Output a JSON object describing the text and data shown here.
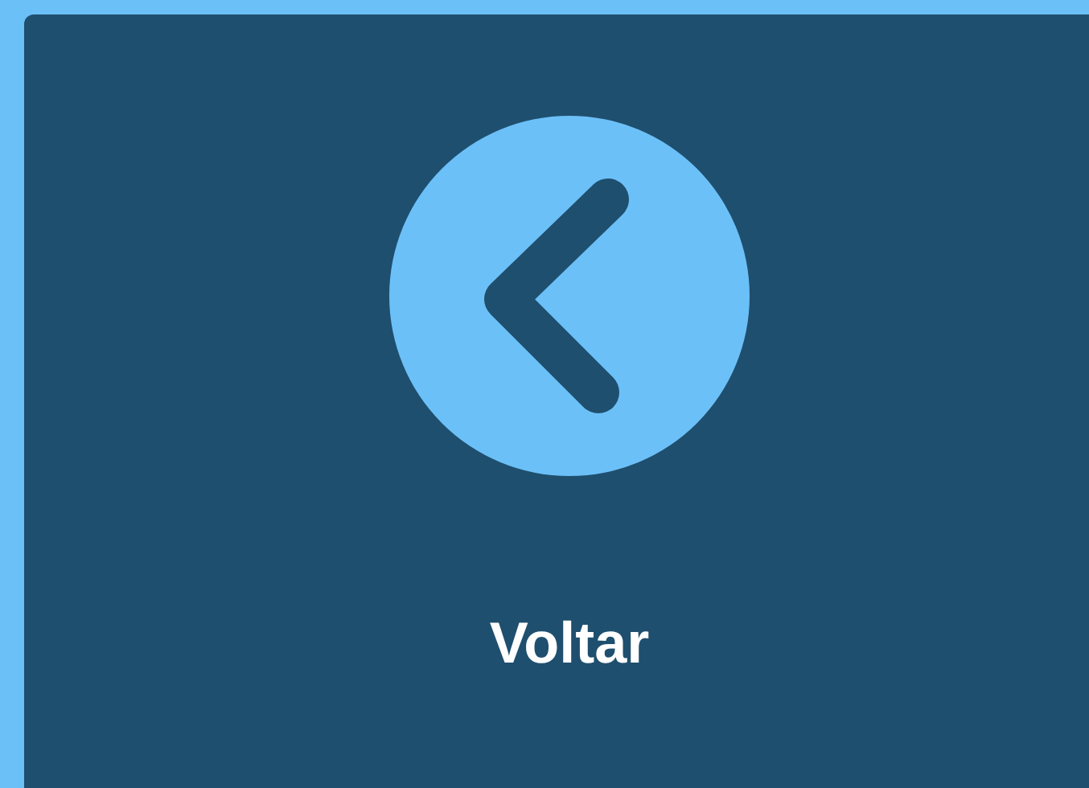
{
  "button": {
    "label": "Voltar"
  }
}
